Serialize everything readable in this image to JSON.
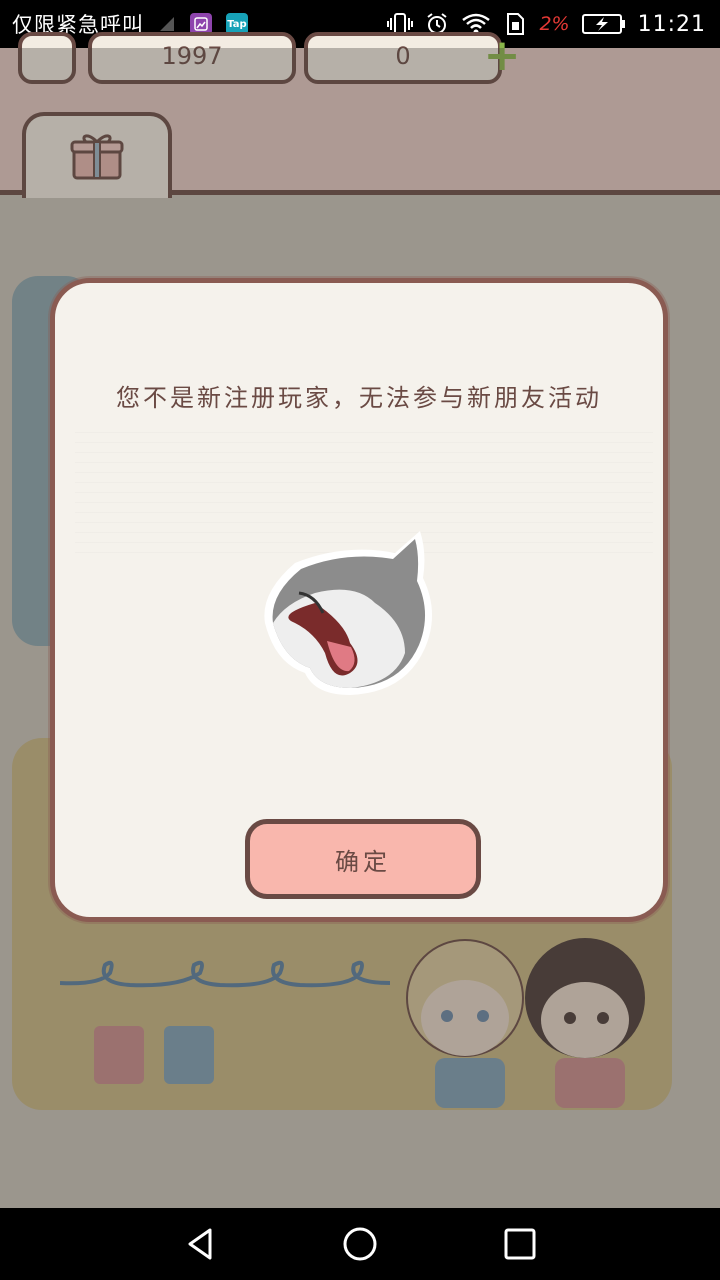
{
  "status_bar": {
    "carrier": "仅限紧急呼叫",
    "battery_percent": "2%",
    "time": "11:21",
    "icons": [
      "no-signal-icon",
      "gallery-app-icon",
      "taptap-app-icon",
      "vibrate-icon",
      "alarm-icon",
      "wifi-icon",
      "sim-icon",
      "battery-icon"
    ],
    "tap_app_label": "Tap"
  },
  "game": {
    "coins_value": "1997",
    "gems_value": "0",
    "gift_tab_icon": "gift-icon"
  },
  "dialog": {
    "message": "您不是新注册玩家，无法参与新朋友活动",
    "confirm_label": "确定",
    "sticker": "cat-yawn-sticker"
  },
  "nav_bar": {
    "icons": [
      "back-icon",
      "home-icon",
      "recent-apps-icon"
    ]
  },
  "colors": {
    "accent_border": "#6a4a44",
    "button_fill": "#f9b7ad",
    "dialog_bg": "#f5f2ec"
  }
}
